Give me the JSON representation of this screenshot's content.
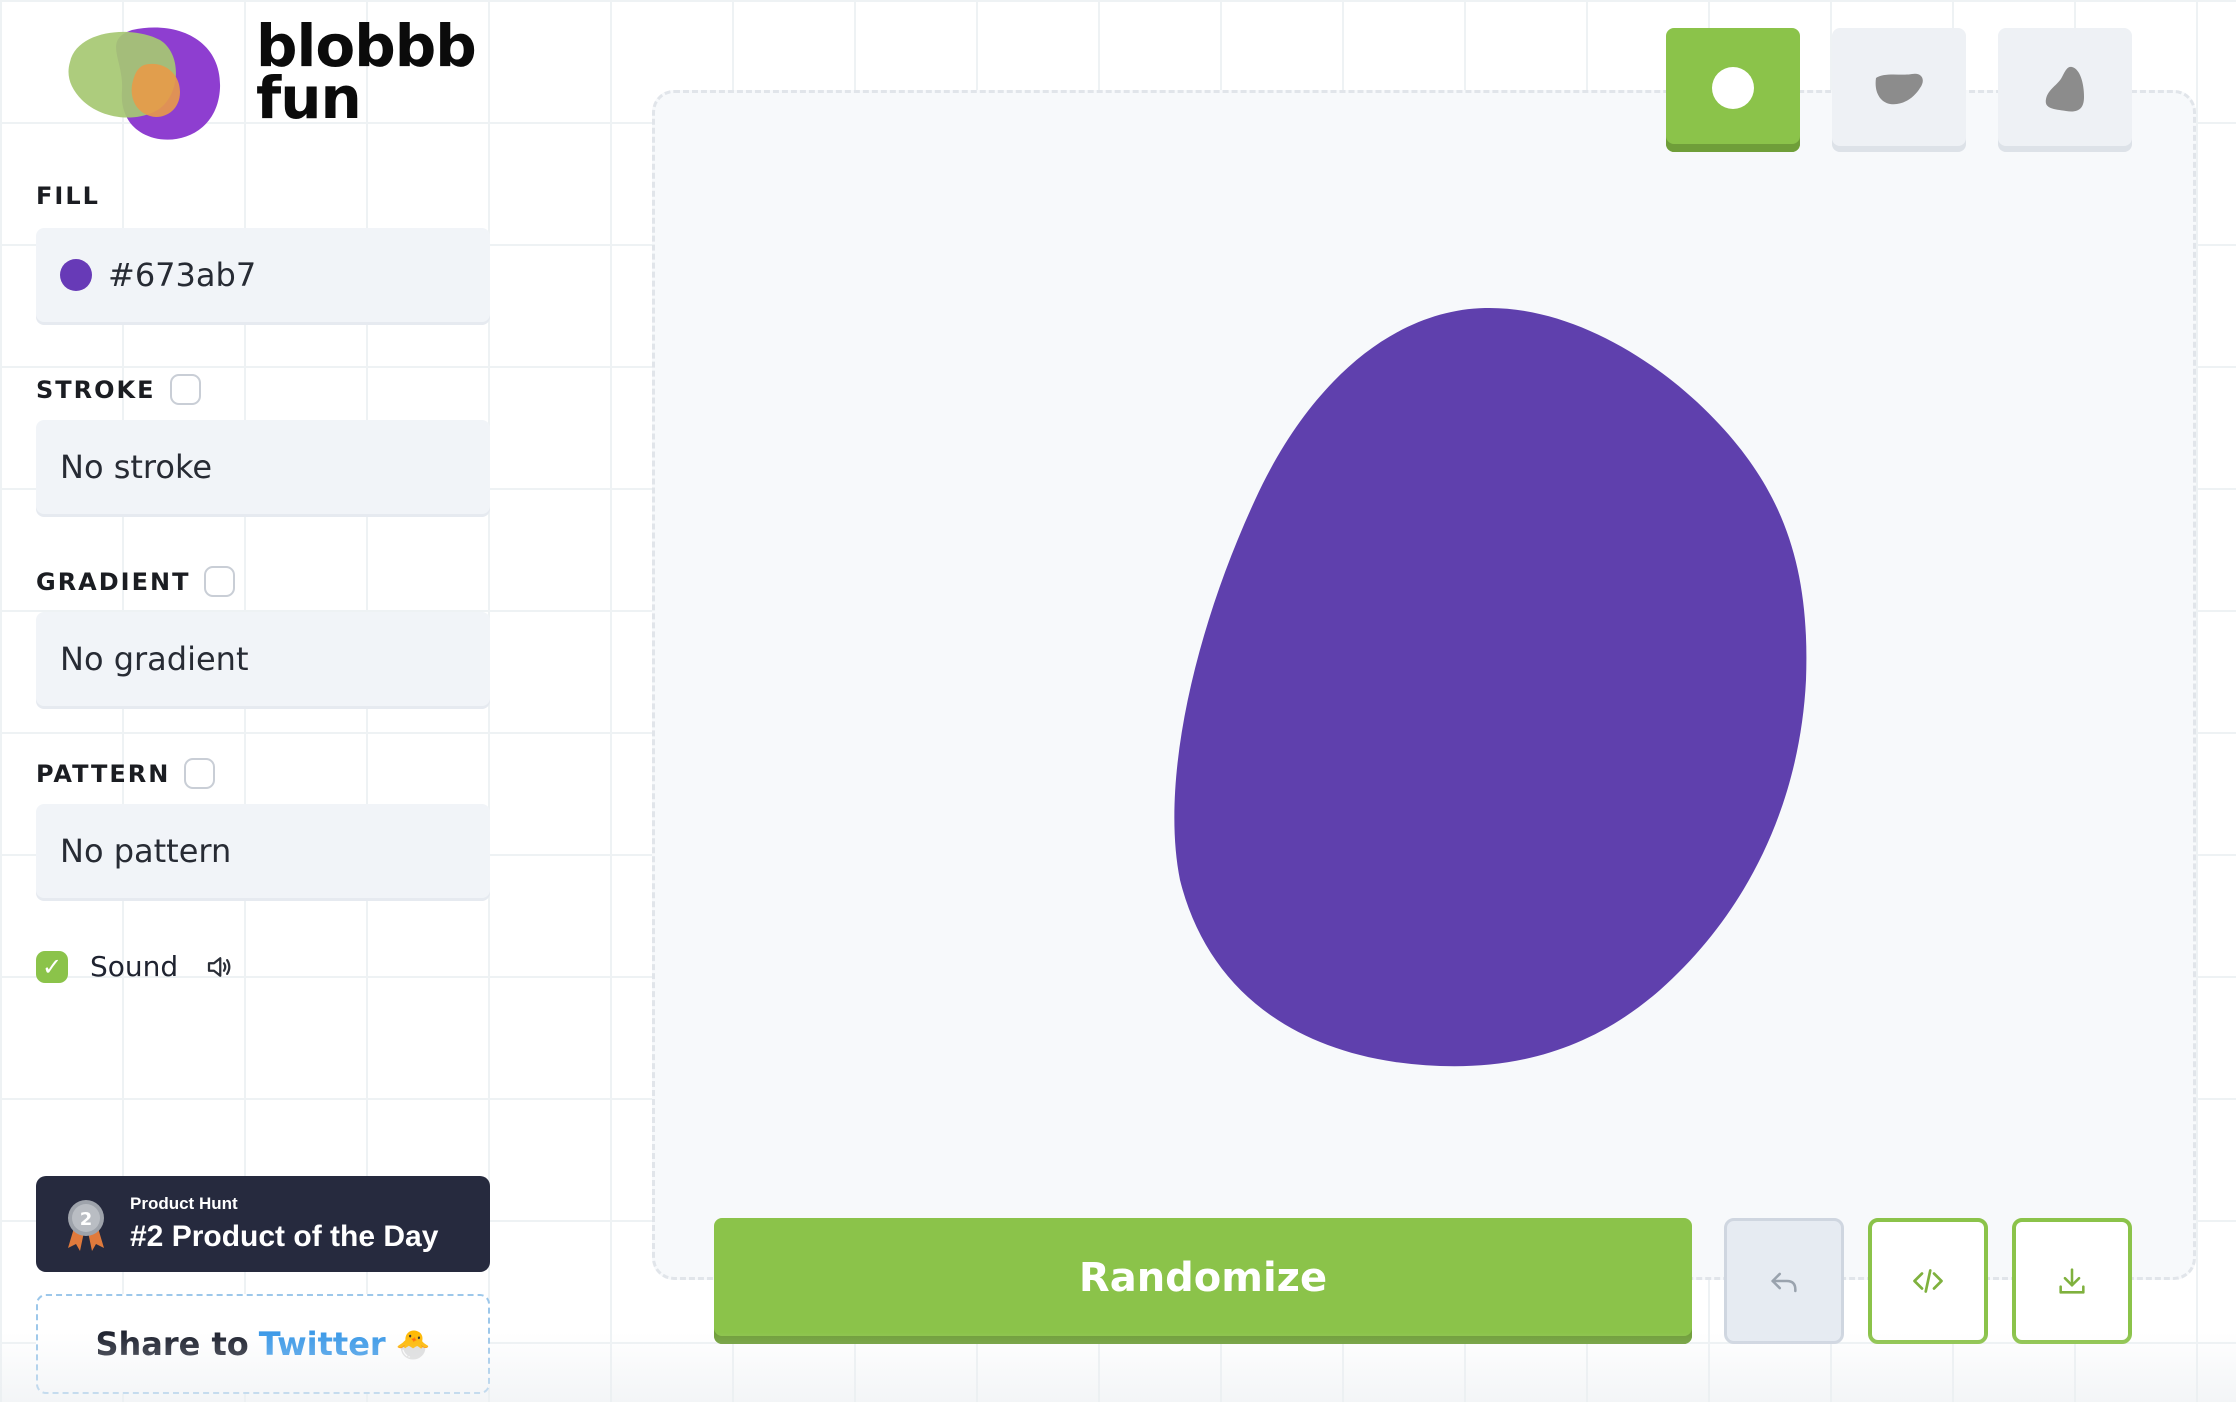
{
  "brand": {
    "line1": "blobbb",
    "line2": "fun"
  },
  "sidebar": {
    "fill": {
      "label": "FILL",
      "value": "#673ab7",
      "swatch_color": "#673ab7"
    },
    "stroke": {
      "label": "STROKE",
      "checked": false,
      "value": "No stroke"
    },
    "gradient": {
      "label": "GRADIENT",
      "checked": false,
      "value": "No gradient"
    },
    "pattern": {
      "label": "PATTERN",
      "checked": false,
      "value": "No pattern"
    },
    "sound": {
      "label": "Sound",
      "checked": true
    }
  },
  "product_hunt": {
    "small": "Product Hunt",
    "big": "#2 Product of the Day",
    "medal_number": "2"
  },
  "share": {
    "prefix": "Share to",
    "network": "Twitter",
    "emoji": "🐣"
  },
  "canvas": {
    "blob_color": "#5f40ad",
    "shape_buttons": [
      {
        "name": "circle-blob",
        "active": true
      },
      {
        "name": "wide-blob",
        "active": false
      },
      {
        "name": "spiky-blob",
        "active": false
      }
    ]
  },
  "actions": {
    "randomize": "Randomize",
    "undo_icon": "undo-icon",
    "code_icon": "code-icon",
    "download_icon": "download-icon"
  },
  "colors": {
    "accent": "#8bc34a",
    "dark": "#262a3e",
    "twitter": "#3d9ae8"
  }
}
